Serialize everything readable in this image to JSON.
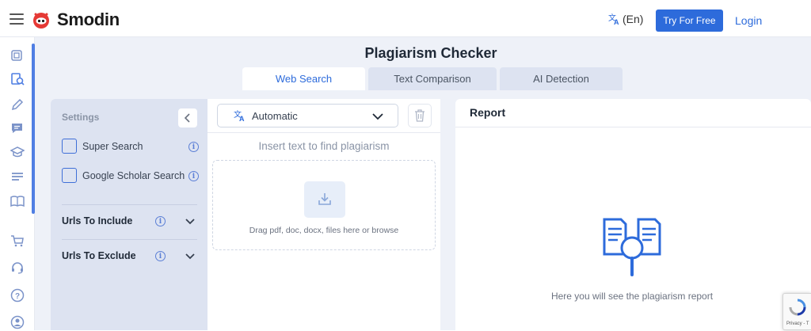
{
  "header": {
    "brand": "Smodin",
    "language": "(En)",
    "try_button": "Try For Free",
    "login": "Login"
  },
  "sidebar": {
    "icons": [
      "copy-icon",
      "plagiarism-icon",
      "pen-icon",
      "chat-icon",
      "graduation-cap-icon",
      "lines-icon",
      "book-icon",
      "cart-icon",
      "headset-icon",
      "help-icon",
      "user-icon"
    ]
  },
  "page": {
    "title": "Plagiarism Checker",
    "tabs": [
      {
        "label": "Web Search",
        "active": true
      },
      {
        "label": "Text Comparison",
        "active": false
      },
      {
        "label": "AI Detection",
        "active": false
      }
    ]
  },
  "settings": {
    "title": "Settings",
    "options": [
      {
        "label": "Super Search",
        "checked": false
      },
      {
        "label": "Google Scholar Search",
        "checked": false
      }
    ],
    "accordions": [
      {
        "label": "Urls To Include"
      },
      {
        "label": "Urls To Exclude"
      }
    ]
  },
  "editor": {
    "language_select": "Automatic",
    "placeholder": "Insert text to find plagiarism",
    "dropzone_text": "Drag pdf, doc, docx, files here or browse"
  },
  "report": {
    "title": "Report",
    "empty_message": "Here you will see the plagiarism report"
  },
  "recaptcha": {
    "text": "Privacy - T"
  },
  "colors": {
    "accent": "#2d6bdb",
    "brand_red": "#e53935",
    "panel_bg": "#dde3f1",
    "page_bg": "#eef1f8"
  }
}
